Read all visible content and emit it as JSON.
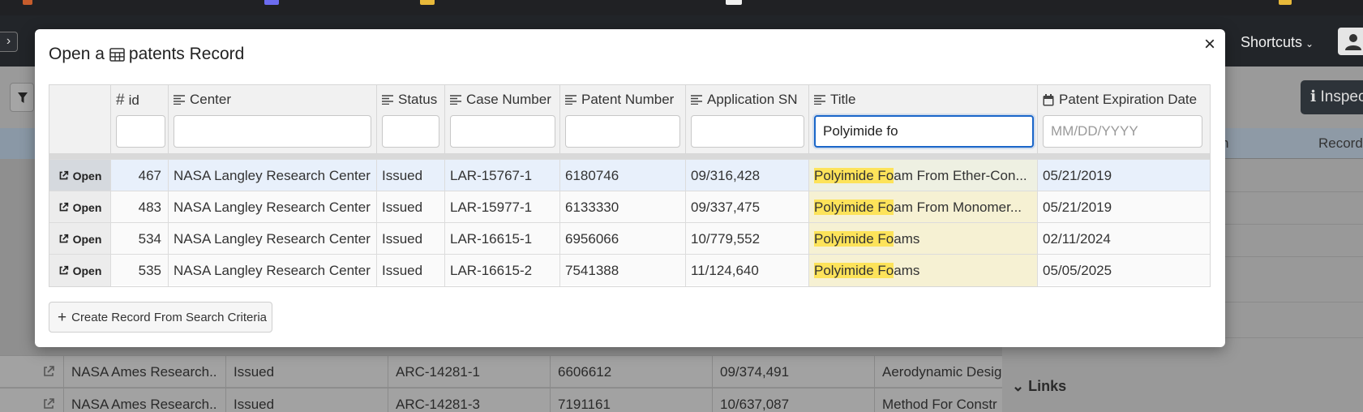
{
  "header": {
    "shortcuts_label": "Shortcuts"
  },
  "background": {
    "inspect_label": "Inspec",
    "right_panel": {
      "col_a": "n",
      "col_b": "Record",
      "links_label": "Links"
    },
    "rows": [
      {
        "center": "NASA Ames Research...",
        "status": "Issued",
        "case": "ARC-14281-1",
        "patent": "6606612",
        "app_sn": "09/374,491",
        "title": "Aerodynamic Desig"
      },
      {
        "center": "NASA Ames Research...",
        "status": "Issued",
        "case": "ARC-14281-3",
        "patent": "7191161",
        "app_sn": "10/637,087",
        "title": "Method For Constr"
      }
    ]
  },
  "modal": {
    "title_prefix": "Open a",
    "table_name": "patents",
    "title_suffix": "Record",
    "close_label": "×",
    "columns": [
      {
        "key": "id",
        "label": "id",
        "icon": "hash-icon",
        "filter": "",
        "placeholder": ""
      },
      {
        "key": "center",
        "label": "Center",
        "icon": "text-lines-icon",
        "filter": "",
        "placeholder": ""
      },
      {
        "key": "status",
        "label": "Status",
        "icon": "text-lines-icon",
        "filter": "",
        "placeholder": ""
      },
      {
        "key": "case",
        "label": "Case Number",
        "icon": "text-lines-icon",
        "filter": "",
        "placeholder": ""
      },
      {
        "key": "patent",
        "label": "Patent Number",
        "icon": "text-lines-icon",
        "filter": "",
        "placeholder": ""
      },
      {
        "key": "app_sn",
        "label": "Application SN",
        "icon": "text-lines-icon",
        "filter": "",
        "placeholder": ""
      },
      {
        "key": "title",
        "label": "Title",
        "icon": "text-lines-icon",
        "filter": "Polyimide fo",
        "placeholder": ""
      },
      {
        "key": "expiry",
        "label": "Patent Expiration Date",
        "icon": "calendar-icon",
        "filter": "",
        "placeholder": "MM/DD/YYYY"
      }
    ],
    "open_label": "Open",
    "rows": [
      {
        "id": "467",
        "center": "NASA Langley Research Center",
        "status": "Issued",
        "case": "LAR-15767-1",
        "patent": "6180746",
        "app_sn": "09/316,428",
        "title_match": "Polyimide Fo",
        "title_rest": "am From Ether-Con...",
        "expiry": "05/21/2019"
      },
      {
        "id": "483",
        "center": "NASA Langley Research Center",
        "status": "Issued",
        "case": "LAR-15977-1",
        "patent": "6133330",
        "app_sn": "09/337,475",
        "title_match": "Polyimide Fo",
        "title_rest": "am From Monomer...",
        "expiry": "05/21/2019"
      },
      {
        "id": "534",
        "center": "NASA Langley Research Center",
        "status": "Issued",
        "case": "LAR-16615-1",
        "patent": "6956066",
        "app_sn": "10/779,552",
        "title_match": "Polyimide Fo",
        "title_rest": "ams",
        "expiry": "02/11/2024"
      },
      {
        "id": "535",
        "center": "NASA Langley Research Center",
        "status": "Issued",
        "case": "LAR-16615-2",
        "patent": "7541388",
        "app_sn": "11/124,640",
        "title_match": "Polyimide Fo",
        "title_rest": "ams",
        "expiry": "05/05/2025"
      }
    ],
    "create_label": "Create Record From Search Criteria"
  },
  "colors": {
    "accent_focus": "#1a66c9",
    "highlight": "#fde35a",
    "header_bg": "#222529"
  }
}
